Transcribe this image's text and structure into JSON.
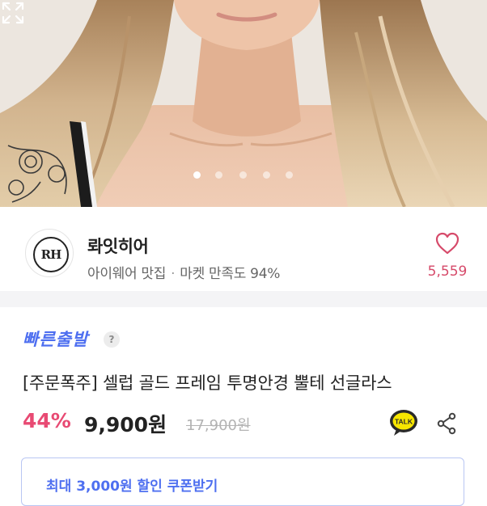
{
  "gallery": {
    "slides_total": 5,
    "active_index": 0
  },
  "store": {
    "logo_text": "RH",
    "name": "롸잇히어",
    "category": "아이웨어 맛집",
    "satisfaction": "마켓 만족도 94%",
    "like_count": "5,559"
  },
  "product": {
    "badge": "빠른출발",
    "help_symbol": "?",
    "title": "[주문폭주] 셀럽 골드 프레임 투명안경 뿔테 선글라스",
    "discount": "44%",
    "price": "9,900원",
    "original_price": "17,900원",
    "coupon_label": "최대 3,000원 할인 쿠폰받기"
  },
  "actions": {
    "talk_label": "TALK"
  },
  "colors": {
    "accent_blue": "#4e6ff0",
    "accent_pink": "#e84a73",
    "like_pink": "#d64a6a"
  }
}
